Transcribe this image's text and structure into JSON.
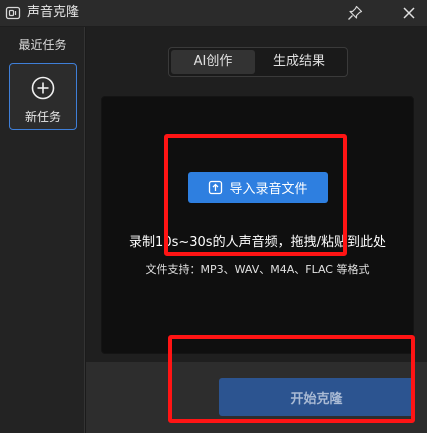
{
  "window": {
    "title": "声音克隆",
    "icons": {
      "app": "app-icon",
      "pin": "pin-icon",
      "close": "close-icon"
    }
  },
  "sidebar": {
    "title": "最近任务",
    "new_task": {
      "icon": "plus-circle-icon",
      "label": "新任务"
    }
  },
  "tabs": [
    {
      "label": "AI创作",
      "active": true
    },
    {
      "label": "生成结果",
      "active": false
    }
  ],
  "upload": {
    "button_label": "导入录音文件",
    "button_icon": "upload-icon",
    "hint_main": "录制10s~30s的人声音频，拖拽/粘贴到此处",
    "hint_formats": "文件支持：MP3、WAV、M4A、FLAC 等格式"
  },
  "actions": {
    "start_label": "开始克隆"
  },
  "colors": {
    "accent": "#2e7fe0",
    "start_button_disabled": "#2c5490",
    "annotation": "#ff1414"
  }
}
